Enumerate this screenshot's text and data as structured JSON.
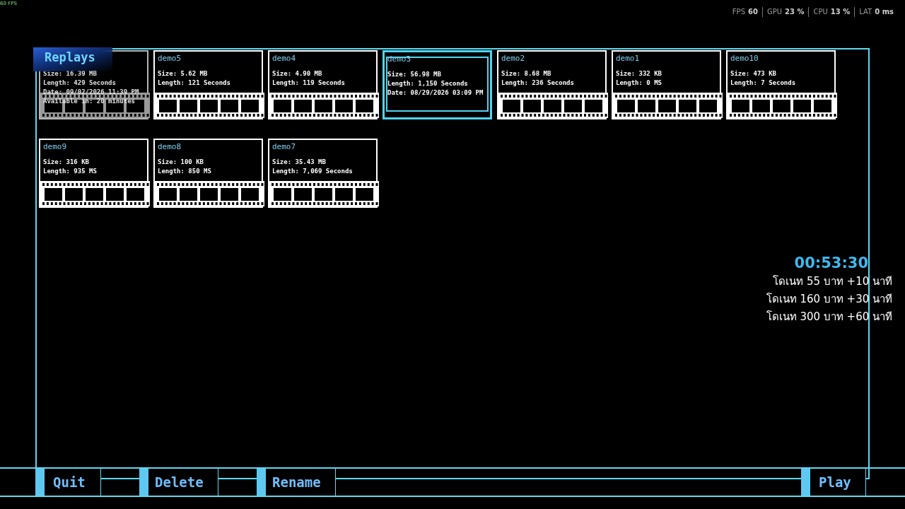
{
  "fps_counter": "60 FPS",
  "stats": [
    {
      "label": "FPS",
      "value": "60"
    },
    {
      "label": "GPU",
      "value": "23 %"
    },
    {
      "label": "CPU",
      "value": "13 %"
    },
    {
      "label": "LAT",
      "value": "0 ms"
    }
  ],
  "title": "Replays",
  "replays": [
    {
      "size": "Size: 16.39 MB",
      "length": "Length: 429 Seconds",
      "date": "Date: 09/02/2026 11:39 PM",
      "availability": "Available in: 20 minutes",
      "disabled": true,
      "selected": false
    },
    {
      "name": "demo5",
      "size": "Size: 5.62 MB",
      "length": "Length: 121 Seconds",
      "disabled": false,
      "selected": false
    },
    {
      "name": "demo4",
      "size": "Size: 4.90 MB",
      "length": "Length: 119 Seconds",
      "disabled": false,
      "selected": false
    },
    {
      "name": "demo3",
      "size": "Size: 56.98 MB",
      "length": "Length: 1,150 Seconds",
      "date": "Date: 08/29/2026 03:09 PM",
      "disabled": false,
      "selected": true
    },
    {
      "name": "demo2",
      "size": "Size: 8.68 MB",
      "length": "Length: 236 Seconds",
      "disabled": false,
      "selected": false
    },
    {
      "name": "demo1",
      "size": "Size: 332 KB",
      "length": "Length: 0 MS",
      "disabled": false,
      "selected": false
    },
    {
      "name": "demo10",
      "size": "Size: 473 KB",
      "length": "Length: 7 Seconds",
      "disabled": false,
      "selected": false
    },
    {
      "name": "demo9",
      "size": "Size: 316 KB",
      "length": "Length: 935 MS",
      "disabled": false,
      "selected": false
    },
    {
      "name": "demo8",
      "size": "Size: 100 KB",
      "length": "Length: 850 MS",
      "disabled": false,
      "selected": false
    },
    {
      "name": "demo7",
      "size": "Size: 35.43 MB",
      "length": "Length: 7,069 Seconds",
      "disabled": false,
      "selected": false
    }
  ],
  "timer": "00:53:30",
  "donations": [
    "โดเนท 55 บาท +10 นาที",
    "โดเนท 160 บาท +30 นาที",
    "โดเนท 300 บาท +60 นาที"
  ],
  "buttons": [
    {
      "label": "Quit"
    },
    {
      "label": "Delete"
    },
    {
      "label": "Rename"
    },
    {
      "label": "Play"
    }
  ]
}
